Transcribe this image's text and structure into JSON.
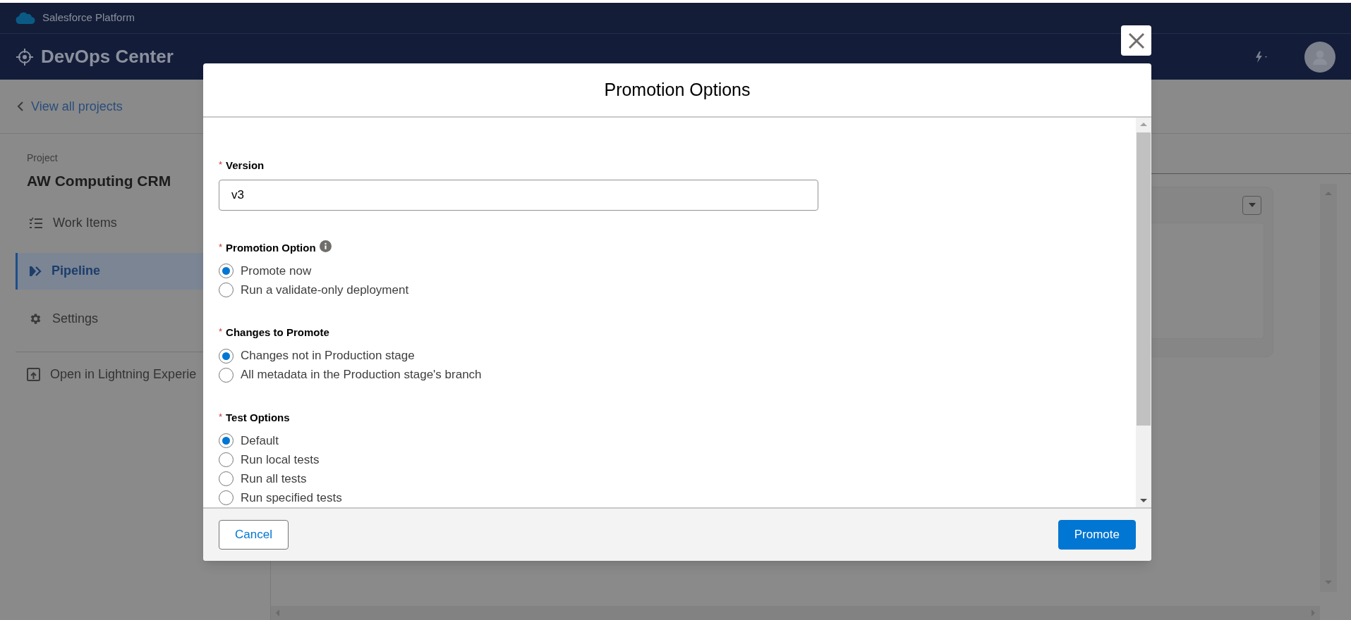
{
  "platform_bar": {
    "title": "Salesforce Platform"
  },
  "app_bar": {
    "title": "DevOps Center"
  },
  "sidebar": {
    "back_link": "View all projects",
    "project_label": "Project",
    "project_name": "AW Computing CRM",
    "items": [
      {
        "kind": "list",
        "label": "Work Items",
        "selected": false
      },
      {
        "kind": "pipeline",
        "label": "Pipeline",
        "selected": true
      },
      {
        "kind": "gear",
        "label": "Settings",
        "selected": false
      }
    ],
    "footer_link": "Open in Lightning Experie"
  },
  "modal": {
    "title": "Promotion Options",
    "fields": [
      {
        "kind": "text",
        "asterisk": "*",
        "label": "Version",
        "info": false,
        "value": "v3"
      },
      {
        "kind": "radio",
        "asterisk": "*",
        "label": "Promotion Option",
        "info": true,
        "options": [
          {
            "label": "Promote now",
            "selected": true
          },
          {
            "label": "Run a validate-only deployment",
            "selected": false
          }
        ]
      },
      {
        "kind": "radio",
        "asterisk": "*",
        "label": "Changes to Promote",
        "info": false,
        "options": [
          {
            "label": "Changes not in Production stage",
            "selected": true
          },
          {
            "label": "All metadata in the Production stage's branch",
            "selected": false
          }
        ]
      },
      {
        "kind": "radio",
        "asterisk": "*",
        "label": "Test Options",
        "info": false,
        "options": [
          {
            "label": "Default",
            "selected": true
          },
          {
            "label": "Run local tests",
            "selected": false
          },
          {
            "label": "Run all tests",
            "selected": false
          },
          {
            "label": "Run specified tests",
            "selected": false
          }
        ]
      }
    ],
    "buttons": [
      {
        "kind": "neutral",
        "label": "Cancel"
      },
      {
        "kind": "brand",
        "label": "Promote"
      }
    ]
  }
}
